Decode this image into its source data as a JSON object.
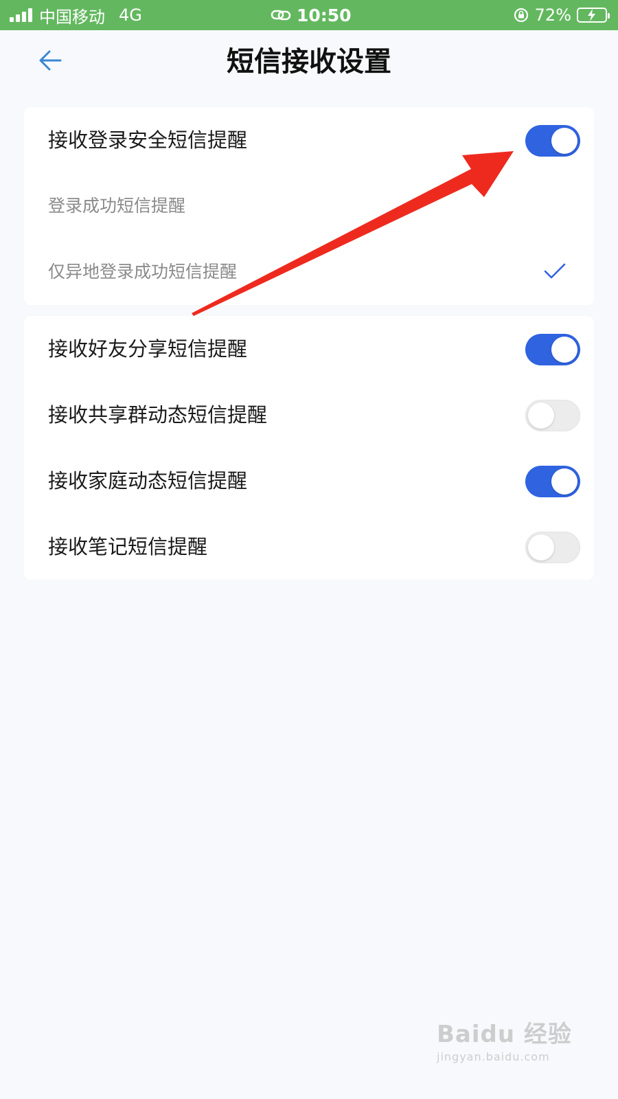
{
  "status_bar": {
    "carrier": "中国移动",
    "network": "4G",
    "time": "10:50",
    "battery_percent": "72%",
    "battery_level": 0.72
  },
  "header": {
    "title": "短信接收设置",
    "back_icon": "arrow-left-icon"
  },
  "section_login": {
    "main_setting": {
      "label": "接收登录安全短信提醒",
      "enabled": true
    },
    "options": [
      {
        "label": "登录成功短信提醒",
        "selected": false
      },
      {
        "label": "仅异地登录成功短信提醒",
        "selected": true
      }
    ]
  },
  "section_other": {
    "settings": [
      {
        "label": "接收好友分享短信提醒",
        "enabled": true
      },
      {
        "label": "接收共享群动态短信提醒",
        "enabled": false
      },
      {
        "label": "接收家庭动态短信提醒",
        "enabled": true
      },
      {
        "label": "接收笔记短信提醒",
        "enabled": false
      }
    ]
  },
  "watermark": {
    "logo": "Baidu 经验",
    "url": "jingyan.baidu.com"
  },
  "colors": {
    "status_bar_bg": "#63b85f",
    "toggle_on": "#2f63e0",
    "toggle_off": "#ececec",
    "accent": "#2f63e0",
    "annotation_arrow": "#ee2a1f",
    "page_bg": "#f7f9fc"
  }
}
